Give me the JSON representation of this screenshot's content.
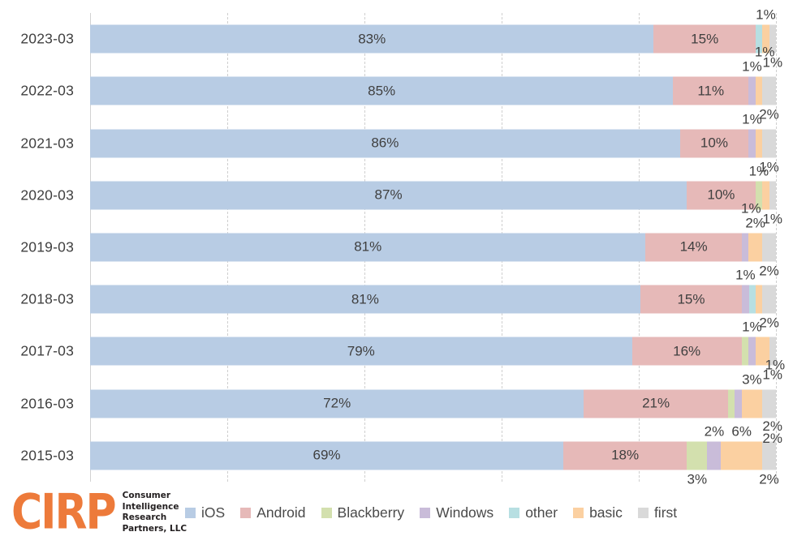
{
  "chart_data": {
    "type": "bar",
    "subtype": "stacked-horizontal-100",
    "title": "",
    "xlabel": "",
    "ylabel": "",
    "xlim": [
      0,
      100
    ],
    "grid": true,
    "gridlines": [
      0,
      20,
      40,
      60,
      80,
      100
    ],
    "legend_position": "bottom",
    "categories": [
      "2023-03",
      "2022-03",
      "2021-03",
      "2020-03",
      "2019-03",
      "2018-03",
      "2017-03",
      "2016-03",
      "2015-03"
    ],
    "series": [
      {
        "name": "iOS",
        "color": "#b8cce4",
        "values": [
          83,
          85,
          86,
          87,
          81,
          81,
          79,
          72,
          69
        ]
      },
      {
        "name": "Android",
        "color": "#e6b9b8",
        "values": [
          15,
          11,
          10,
          10,
          14,
          15,
          16,
          21,
          18
        ]
      },
      {
        "name": "Blackberry",
        "color": "#d3e0ae",
        "values": [
          0,
          0,
          1,
          1,
          0,
          0,
          1,
          1,
          3
        ]
      },
      {
        "name": "Windows",
        "color": "#c9bcd9",
        "values": [
          0,
          1,
          0,
          0,
          1,
          1,
          1,
          1,
          2
        ]
      },
      {
        "name": "other",
        "color": "#b7dfe2",
        "values": [
          1,
          0,
          0,
          0,
          0,
          1,
          0,
          0,
          0
        ]
      },
      {
        "name": "basic",
        "color": "#fbd0a1",
        "values": [
          1,
          1,
          1,
          1,
          2,
          1,
          2,
          3,
          6
        ]
      },
      {
        "name": "first",
        "color": "#d9d9d9",
        "values": [
          1,
          2,
          2,
          1,
          2,
          2,
          1,
          1,
          2
        ]
      }
    ],
    "rows": [
      {
        "category": "2023-03",
        "segments": [
          {
            "series": "iOS",
            "value": 83,
            "label": "83%",
            "label_pos": "inside"
          },
          {
            "series": "Android",
            "value": 15,
            "label": "15%",
            "label_pos": "inside"
          },
          {
            "series": "other",
            "value": 1,
            "label": "",
            "label_pos": "none"
          },
          {
            "series": "basic",
            "value": 1,
            "label": "1%",
            "label_pos": "above"
          },
          {
            "series": "first",
            "value": 1,
            "label": "1%",
            "label_pos": "below"
          }
        ]
      },
      {
        "category": "2022-03",
        "segments": [
          {
            "series": "iOS",
            "value": 85,
            "label": "85%",
            "label_pos": "inside"
          },
          {
            "series": "Android",
            "value": 11,
            "label": "11%",
            "label_pos": "inside"
          },
          {
            "series": "Windows",
            "value": 1,
            "label": "1%",
            "label_pos": "above"
          },
          {
            "series": "basic",
            "value": 1,
            "label": "1%",
            "label_pos": "above2"
          },
          {
            "series": "first",
            "value": 2,
            "label": "2%",
            "label_pos": "below"
          }
        ]
      },
      {
        "category": "2021-03",
        "segments": [
          {
            "series": "iOS",
            "value": 86,
            "label": "86%",
            "label_pos": "inside"
          },
          {
            "series": "Android",
            "value": 10,
            "label": "10%",
            "label_pos": "inside"
          },
          {
            "series": "Windows",
            "value": 1,
            "label": "1%",
            "label_pos": "above"
          },
          {
            "series": "basic",
            "value": 1,
            "label": "",
            "label_pos": "none"
          },
          {
            "series": "first",
            "value": 2,
            "label": "1%",
            "label_pos": "below"
          }
        ]
      },
      {
        "category": "2020-03",
        "segments": [
          {
            "series": "iOS",
            "value": 87,
            "label": "87%",
            "label_pos": "inside"
          },
          {
            "series": "Android",
            "value": 10,
            "label": "10%",
            "label_pos": "inside"
          },
          {
            "series": "Blackberry",
            "value": 1,
            "label": "1%",
            "label_pos": "above"
          },
          {
            "series": "basic",
            "value": 1,
            "label": "",
            "label_pos": "none"
          },
          {
            "series": "first",
            "value": 1,
            "label": "1%",
            "label_pos": "below"
          }
        ]
      },
      {
        "category": "2019-03",
        "segments": [
          {
            "series": "iOS",
            "value": 81,
            "label": "81%",
            "label_pos": "inside"
          },
          {
            "series": "Android",
            "value": 14,
            "label": "14%",
            "label_pos": "inside"
          },
          {
            "series": "Windows",
            "value": 1,
            "label": "1%",
            "label_pos": "above2"
          },
          {
            "series": "basic",
            "value": 2,
            "label": "2%",
            "label_pos": "above"
          },
          {
            "series": "first",
            "value": 2,
            "label": "2%",
            "label_pos": "below"
          }
        ]
      },
      {
        "category": "2018-03",
        "segments": [
          {
            "series": "iOS",
            "value": 81,
            "label": "81%",
            "label_pos": "inside"
          },
          {
            "series": "Android",
            "value": 15,
            "label": "15%",
            "label_pos": "inside"
          },
          {
            "series": "Windows",
            "value": 1,
            "label": "1%",
            "label_pos": "above"
          },
          {
            "series": "other",
            "value": 1,
            "label": "",
            "label_pos": "none"
          },
          {
            "series": "basic",
            "value": 1,
            "label": "",
            "label_pos": "none"
          },
          {
            "series": "first",
            "value": 2,
            "label": "2%",
            "label_pos": "below"
          }
        ]
      },
      {
        "category": "2017-03",
        "segments": [
          {
            "series": "iOS",
            "value": 79,
            "label": "79%",
            "label_pos": "inside"
          },
          {
            "series": "Android",
            "value": 16,
            "label": "16%",
            "label_pos": "inside"
          },
          {
            "series": "Blackberry",
            "value": 1,
            "label": "",
            "label_pos": "none"
          },
          {
            "series": "Windows",
            "value": 1,
            "label": "1%",
            "label_pos": "above"
          },
          {
            "series": "basic",
            "value": 2,
            "label": "",
            "label_pos": "none"
          },
          {
            "series": "first",
            "value": 1,
            "label": "1%",
            "label_pos": "below"
          }
        ]
      },
      {
        "category": "2016-03",
        "segments": [
          {
            "series": "iOS",
            "value": 72,
            "label": "72%",
            "label_pos": "inside"
          },
          {
            "series": "Android",
            "value": 21,
            "label": "21%",
            "label_pos": "inside"
          },
          {
            "series": "Blackberry",
            "value": 1,
            "label": "",
            "label_pos": "none"
          },
          {
            "series": "Windows",
            "value": 1,
            "label": "",
            "label_pos": "none"
          },
          {
            "series": "basic",
            "value": 3,
            "label": "3%",
            "label_pos": "above"
          },
          {
            "series": "first",
            "value": 2,
            "label": "1%",
            "label_pos": "above2"
          }
        ]
      },
      {
        "category": "2015-03",
        "segments": [
          {
            "series": "iOS",
            "value": 69,
            "label": "69%",
            "label_pos": "inside"
          },
          {
            "series": "Android",
            "value": 18,
            "label": "18%",
            "label_pos": "inside"
          },
          {
            "series": "Blackberry",
            "value": 3,
            "label": "3%",
            "label_pos": "below"
          },
          {
            "series": "Windows",
            "value": 2,
            "label": "2%",
            "label_pos": "above"
          },
          {
            "series": "basic",
            "value": 6,
            "label": "6%",
            "label_pos": "above"
          },
          {
            "series": "first",
            "value": 2,
            "label": "2%",
            "label_pos": "below"
          }
        ]
      }
    ],
    "extra_labels": [
      {
        "text": "2%",
        "row": "2016-03",
        "position": "below-right"
      },
      {
        "text": "2%",
        "row": "2015-03",
        "position": "above-right"
      }
    ]
  },
  "legend": {
    "items": [
      {
        "label": "iOS",
        "color": "#b8cce4"
      },
      {
        "label": "Android",
        "color": "#e6b9b8"
      },
      {
        "label": "Blackberry",
        "color": "#d3e0ae"
      },
      {
        "label": "Windows",
        "color": "#c9bcd9"
      },
      {
        "label": "other",
        "color": "#b7dfe2"
      },
      {
        "label": "basic",
        "color": "#fbd0a1"
      },
      {
        "label": "first",
        "color": "#d9d9d9"
      }
    ]
  },
  "branding": {
    "mark": "CIRP",
    "line1": "Consumer",
    "line2": "Intelligence",
    "line3": "Research",
    "line4": "Partners, LLC",
    "accent_color": "#ED7A3A"
  }
}
